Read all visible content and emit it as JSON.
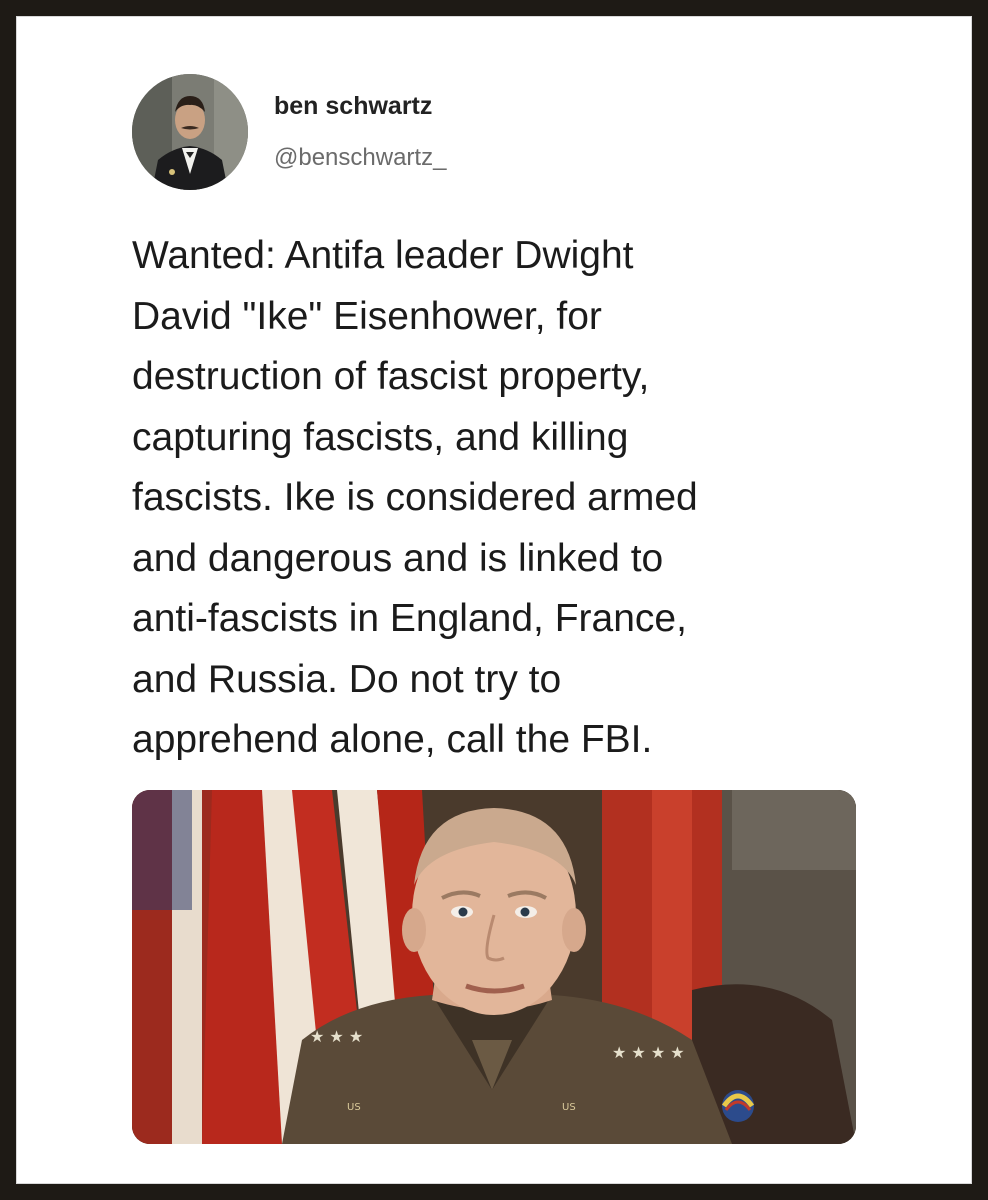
{
  "tweet": {
    "author": {
      "display_name": "ben schwartz",
      "handle": "@benschwartz_",
      "avatar": "profile-photo-man-in-tuxedo"
    },
    "text_lines": [
      "Wanted:  Antifa leader Dwight",
      "David \"Ike\" Eisenhower, for",
      "destruction of fascist property,",
      "capturing fascists, and killing",
      "fascists. Ike is considered armed",
      "and dangerous and is linked to",
      "anti-fascists in England, France,",
      "and Russia.  Do not try to",
      "apprehend alone, call the FBI."
    ],
    "media": {
      "type": "photo",
      "subject": "portrait-general-in-uniform-before-flags"
    }
  },
  "colors": {
    "frame": "#1e1a15",
    "card": "#ffffff",
    "text": "#1b1b1b",
    "handle": "#6b6b6b"
  }
}
